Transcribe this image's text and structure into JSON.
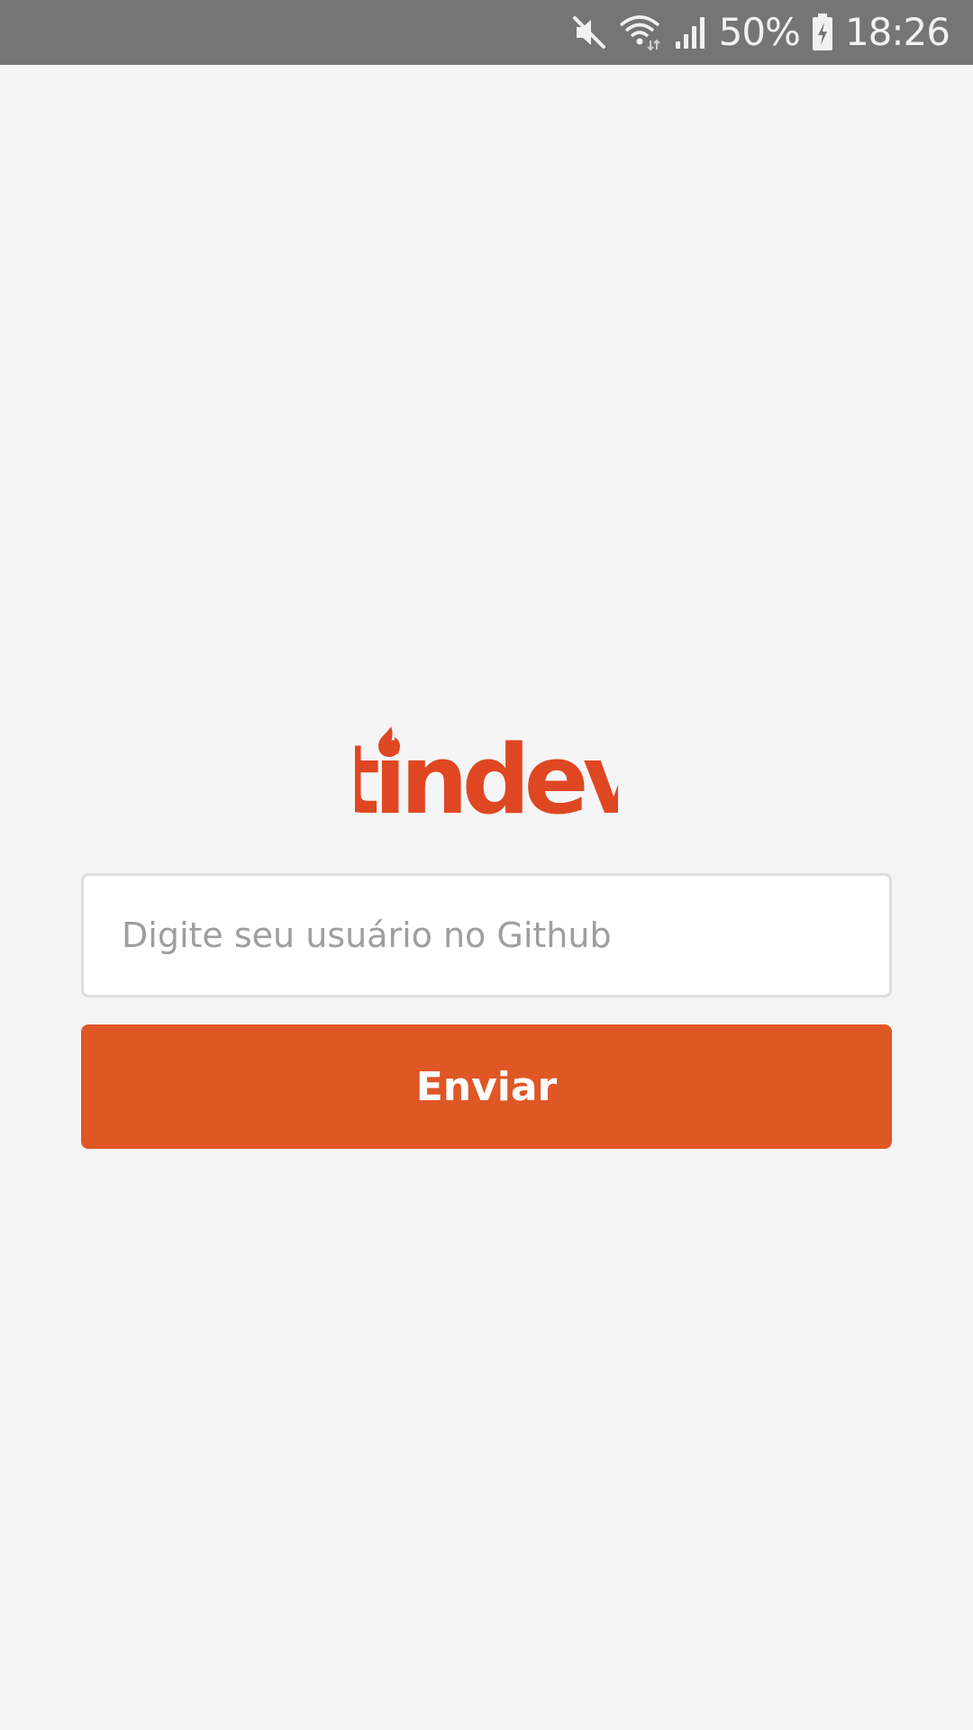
{
  "status_bar": {
    "battery": "50%",
    "time": "18:26",
    "icons": [
      "mute-icon",
      "wifi-icon",
      "signal-icon",
      "battery-charging-icon"
    ]
  },
  "logo": {
    "text": "tindev",
    "icon": "flame-icon",
    "color": "#df4723"
  },
  "login": {
    "username_placeholder": "Digite seu usuário no Github",
    "username_value": "",
    "submit_label": "Enviar"
  },
  "colors": {
    "background": "#f5f5f5",
    "status_bar": "#757575",
    "accent": "#df5724"
  }
}
